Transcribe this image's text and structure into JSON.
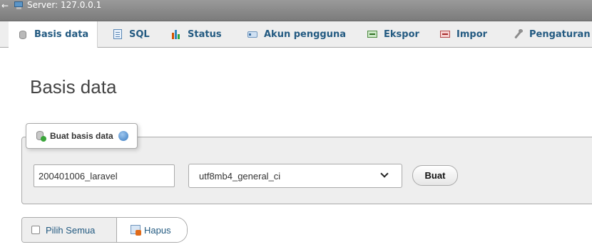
{
  "topbar": {
    "back_glyph": "←",
    "server_label": "Server: 127.0.0.1"
  },
  "tabs": [
    {
      "label": "Basis data",
      "icon": "database-icon",
      "active": true
    },
    {
      "label": "SQL",
      "icon": "sql-icon",
      "active": false
    },
    {
      "label": "Status",
      "icon": "status-icon",
      "active": false
    },
    {
      "label": "Akun pengguna",
      "icon": "user-accounts-icon",
      "active": false
    },
    {
      "label": "Ekspor",
      "icon": "export-icon",
      "active": false
    },
    {
      "label": "Impor",
      "icon": "import-icon",
      "active": false
    },
    {
      "label": "Pengaturan",
      "icon": "wrench-icon",
      "active": false
    }
  ],
  "page": {
    "title": "Basis data"
  },
  "create_db": {
    "legend": "Buat basis data",
    "name_value": "200401006_laravel",
    "collation_value": "utf8mb4_general_ci",
    "create_label": "Buat"
  },
  "actions": {
    "select_all_label": "Pilih Semua",
    "delete_label": "Hapus"
  },
  "colors": {
    "link": "#235a81",
    "topbar": "#888888",
    "panel": "#eeeeee"
  }
}
